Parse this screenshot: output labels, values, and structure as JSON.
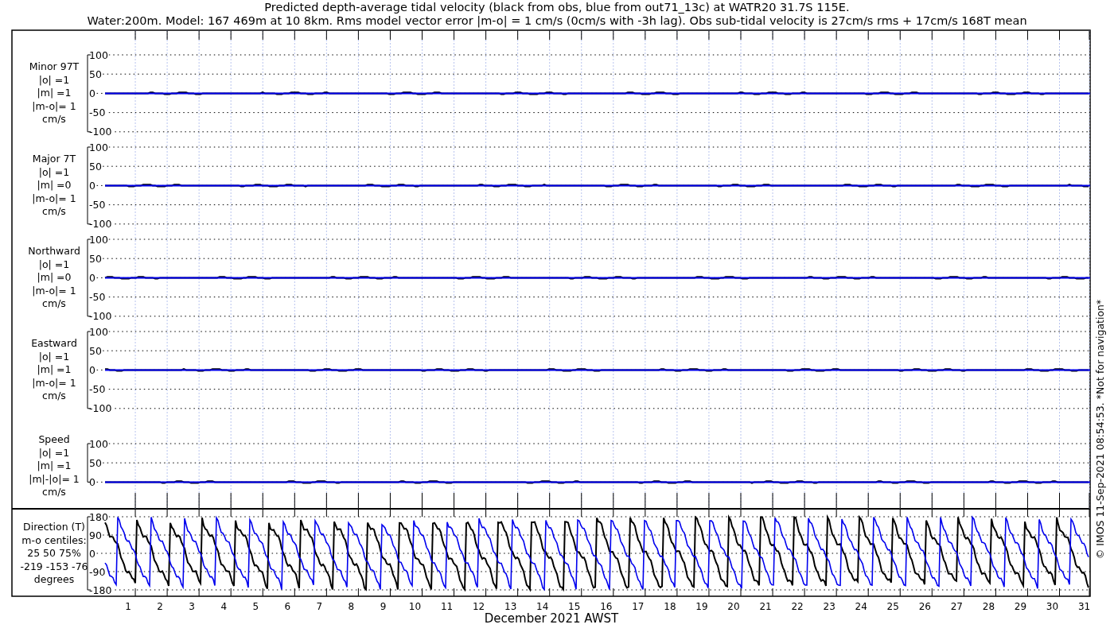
{
  "title": [
    "Predicted depth-average tidal velocity (black from obs, blue from out71_13c) at WATR20 31.7S 115E.",
    "Water:200m. Model: 167 469m at 10 8km. Rms model vector error |m-o| = 1 cm/s (0cm/s with -3h lag). Obs sub-tidal velocity is 27cm/s rms + 17cm/s 168T mean"
  ],
  "panels": [
    {
      "kind": "velocity",
      "label_lines": [
        "Minor 97T",
        "|o| =1",
        "|m| =1",
        "|m-o|= 1",
        "cm/s"
      ],
      "yticks": [
        "100",
        "50",
        "0",
        "-50",
        "-100"
      ]
    },
    {
      "kind": "velocity",
      "label_lines": [
        "Major 7T",
        "|o| =1",
        "|m| =0",
        "|m-o|= 1",
        "cm/s"
      ],
      "yticks": [
        "100",
        "50",
        "0",
        "-50",
        "-100"
      ]
    },
    {
      "kind": "velocity",
      "label_lines": [
        "Northward",
        "|o| =1",
        "|m| =0",
        "|m-o|= 1",
        "cm/s"
      ],
      "yticks": [
        "100",
        "50",
        "0",
        "-50",
        "-100"
      ]
    },
    {
      "kind": "velocity",
      "label_lines": [
        "Eastward",
        "|o| =1",
        "|m| =1",
        "|m-o|= 1",
        "cm/s"
      ],
      "yticks": [
        "100",
        "50",
        "0",
        "-50",
        "-100"
      ]
    },
    {
      "kind": "speed",
      "label_lines": [
        "Speed",
        "|o| =1",
        "|m| =1",
        "|m|-|o|= 1",
        "cm/s"
      ],
      "yticks": [
        "100",
        "50",
        "0"
      ]
    },
    {
      "kind": "direction",
      "label_lines": [
        "Direction (T)",
        "m-o centiles:",
        "25  50  75%",
        "-219 -153  -76",
        "degrees"
      ],
      "yticks": [
        "180",
        "90",
        "0",
        "-90",
        "-180"
      ]
    }
  ],
  "day_labels": [
    "1",
    "2",
    "3",
    "4",
    "5",
    "6",
    "7",
    "8",
    "9",
    "10",
    "11",
    "12",
    "13",
    "14",
    "15",
    "16",
    "17",
    "18",
    "19",
    "20",
    "21",
    "22",
    "23",
    "24",
    "25",
    "26",
    "27",
    "28",
    "29",
    "30",
    "31"
  ],
  "xlabel": "December 2021 AWST",
  "footer": "© IMOS 11-Sep-2021 08:54:53. *Not for navigation*"
}
